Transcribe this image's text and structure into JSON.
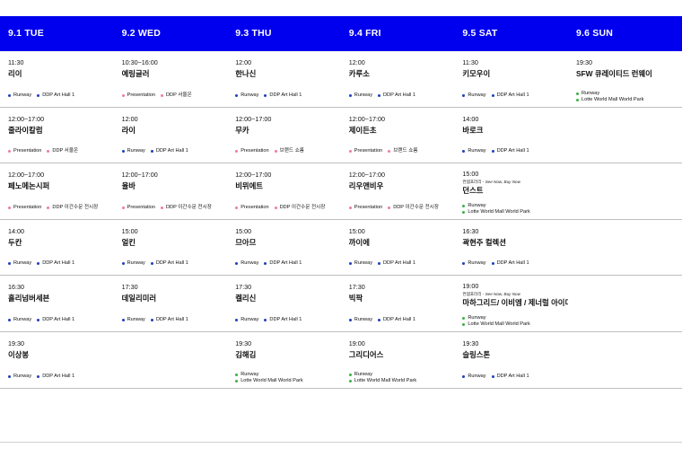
{
  "days": [
    "9.1 TUE",
    "9.2 WED",
    "9.3 THU",
    "9.4 FRI",
    "9.5 SAT",
    "9.6 SUN"
  ],
  "colors": {
    "header_bg": "#0000ee",
    "runway_dot": "#1d3fbf",
    "green_dot": "#3cb043",
    "presentation_dot": "#f07aa0"
  },
  "rows": [
    [
      {
        "time": "11:30",
        "title": "리이",
        "tags": [
          {
            "label": "Runway",
            "dot": "runway"
          },
          {
            "label": "DDP Art Hall 1",
            "dot": "runway"
          }
        ]
      },
      {
        "time": "10:30~16:00",
        "title": "예링글러",
        "tags": [
          {
            "label": "Presentation",
            "dot": "presentation"
          },
          {
            "label": "DDP 서울온",
            "dot": "presentation"
          }
        ]
      },
      {
        "time": "12:00",
        "title": "한나신",
        "tags": [
          {
            "label": "Runway",
            "dot": "runway"
          },
          {
            "label": "DDP Art Hall 1",
            "dot": "runway"
          }
        ]
      },
      {
        "time": "12:00",
        "title": "카루소",
        "tags": [
          {
            "label": "Runway",
            "dot": "runway"
          },
          {
            "label": "DDP Art Hall 1",
            "dot": "runway"
          }
        ]
      },
      {
        "time": "11:30",
        "title": "키모우이",
        "tags": [
          {
            "label": "Runway",
            "dot": "runway"
          },
          {
            "label": "DDP Art Hall 1",
            "dot": "runway"
          }
        ]
      },
      {
        "time": "19:30",
        "title": "SFW 큐레이티드 런웨이",
        "stack": true,
        "tags": [
          {
            "label": "Runway",
            "dot": "runway-green"
          },
          {
            "label": "Lotte World Mall World Park",
            "dot": "runway-green"
          }
        ]
      }
    ],
    [
      {
        "time": "12:00~17:00",
        "title": "줄라이칼럼",
        "tags": [
          {
            "label": "Presentation",
            "dot": "presentation"
          },
          {
            "label": "DDP 서울온",
            "dot": "presentation"
          }
        ]
      },
      {
        "time": "12:00",
        "title": "라이",
        "tags": [
          {
            "label": "Runway",
            "dot": "runway"
          },
          {
            "label": "DDP Art Hall 1",
            "dot": "runway"
          }
        ]
      },
      {
        "time": "12:00~17:00",
        "title": "무카",
        "tags": [
          {
            "label": "Presentation",
            "dot": "presentation"
          },
          {
            "label": "브랜드 쇼룸",
            "dot": "presentation"
          }
        ]
      },
      {
        "time": "12:00~17:00",
        "title": "제이든초",
        "tags": [
          {
            "label": "Presentation",
            "dot": "presentation"
          },
          {
            "label": "브랜드 쇼룸",
            "dot": "presentation"
          }
        ]
      },
      {
        "time": "14:00",
        "title": "바로크",
        "tags": [
          {
            "label": "Runway",
            "dot": "runway"
          },
          {
            "label": "DDP Art Hall 1",
            "dot": "runway"
          }
        ]
      },
      null
    ],
    [
      {
        "time": "12:00~17:00",
        "title": "페노메논시퍼",
        "tags": [
          {
            "label": "Presentation",
            "dot": "presentation"
          },
          {
            "label": "DDP 이간수문 전시장",
            "dot": "presentation"
          }
        ]
      },
      {
        "time": "12:00~17:00",
        "title": "율바",
        "tags": [
          {
            "label": "Presentation",
            "dot": "presentation"
          },
          {
            "label": "DDP 이간수문 전시장",
            "dot": "presentation"
          }
        ]
      },
      {
        "time": "12:00~17:00",
        "title": "비뮈에트",
        "tags": [
          {
            "label": "Presentation",
            "dot": "presentation"
          },
          {
            "label": "DDP 이간수문 전시장",
            "dot": "presentation"
          }
        ]
      },
      {
        "time": "12:00~17:00",
        "title": "리우앤비우",
        "tags": [
          {
            "label": "Presentation",
            "dot": "presentation"
          },
          {
            "label": "DDP 이간수문 전시장",
            "dot": "presentation"
          }
        ]
      },
      {
        "time": "15:00",
        "note": "컨템포러리 - ",
        "note_italic": "See Now, Buy Now",
        "title": "던스트",
        "stack": true,
        "tags": [
          {
            "label": "Runway",
            "dot": "runway-green"
          },
          {
            "label": "Lotte World Mall World Park",
            "dot": "runway-green"
          }
        ]
      },
      null
    ],
    [
      {
        "time": "14:00",
        "title": "두칸",
        "tags": [
          {
            "label": "Runway",
            "dot": "runway"
          },
          {
            "label": "DDP Art Hall 1",
            "dot": "runway"
          }
        ]
      },
      {
        "time": "15:00",
        "title": "얼킨",
        "tags": [
          {
            "label": "Runway",
            "dot": "runway"
          },
          {
            "label": "DDP Art Hall 1",
            "dot": "runway"
          }
        ]
      },
      {
        "time": "15:00",
        "title": "므아므",
        "tags": [
          {
            "label": "Runway",
            "dot": "runway"
          },
          {
            "label": "DDP Art Hall 1",
            "dot": "runway"
          }
        ]
      },
      {
        "time": "15:00",
        "title": "까이에",
        "tags": [
          {
            "label": "Runway",
            "dot": "runway"
          },
          {
            "label": "DDP Art Hall 1",
            "dot": "runway"
          }
        ]
      },
      {
        "time": "16:30",
        "title": "곽현주 컬렉션",
        "tags": [
          {
            "label": "Runway",
            "dot": "runway"
          },
          {
            "label": "DDP Art Hall 1",
            "dot": "runway"
          }
        ]
      },
      null
    ],
    [
      {
        "time": "16:30",
        "title": "홀리넘버세븐",
        "tags": [
          {
            "label": "Runway",
            "dot": "runway"
          },
          {
            "label": "DDP Art Hall 1",
            "dot": "runway"
          }
        ]
      },
      {
        "time": "17:30",
        "title": "데일리미러",
        "tags": [
          {
            "label": "Runway",
            "dot": "runway"
          },
          {
            "label": "DDP Art Hall 1",
            "dot": "runway"
          }
        ]
      },
      {
        "time": "17:30",
        "title": "켈리신",
        "tags": [
          {
            "label": "Runway",
            "dot": "runway"
          },
          {
            "label": "DDP Art Hall 1",
            "dot": "runway"
          }
        ]
      },
      {
        "time": "17:30",
        "title": "빅팍",
        "tags": [
          {
            "label": "Runway",
            "dot": "runway"
          },
          {
            "label": "DDP Art Hall 1",
            "dot": "runway"
          }
        ]
      },
      {
        "time": "19:00",
        "note": "컨템포러리 - ",
        "note_italic": "See Now, Buy Now",
        "title": "마하그리드/ 이비엠 / 제너럴 아이디어",
        "stack": true,
        "tags": [
          {
            "label": "Runway",
            "dot": "runway-green"
          },
          {
            "label": "Lotte World Mall World Park",
            "dot": "runway-green"
          }
        ]
      },
      null
    ],
    [
      {
        "time": "19:30",
        "title": "이상봉",
        "tags": [
          {
            "label": "Runway",
            "dot": "runway"
          },
          {
            "label": "DDP Art Hall 1",
            "dot": "runway"
          }
        ]
      },
      null,
      {
        "time": "19:30",
        "title": "김해김",
        "stack": true,
        "tags": [
          {
            "label": "Runway",
            "dot": "runway-green"
          },
          {
            "label": "Lotte World Mall World Park",
            "dot": "runway-green"
          }
        ]
      },
      {
        "time": "19:00",
        "title": "그리디어스",
        "stack": true,
        "tags": [
          {
            "label": "Runway",
            "dot": "runway-green"
          },
          {
            "label": "Lotte World Mall World Park",
            "dot": "runway-green"
          }
        ]
      },
      {
        "time": "19:30",
        "title": "슬링스톤",
        "tags": [
          {
            "label": "Runway",
            "dot": "runway"
          },
          {
            "label": "DDP Art Hall 1",
            "dot": "runway"
          }
        ]
      },
      null
    ]
  ]
}
